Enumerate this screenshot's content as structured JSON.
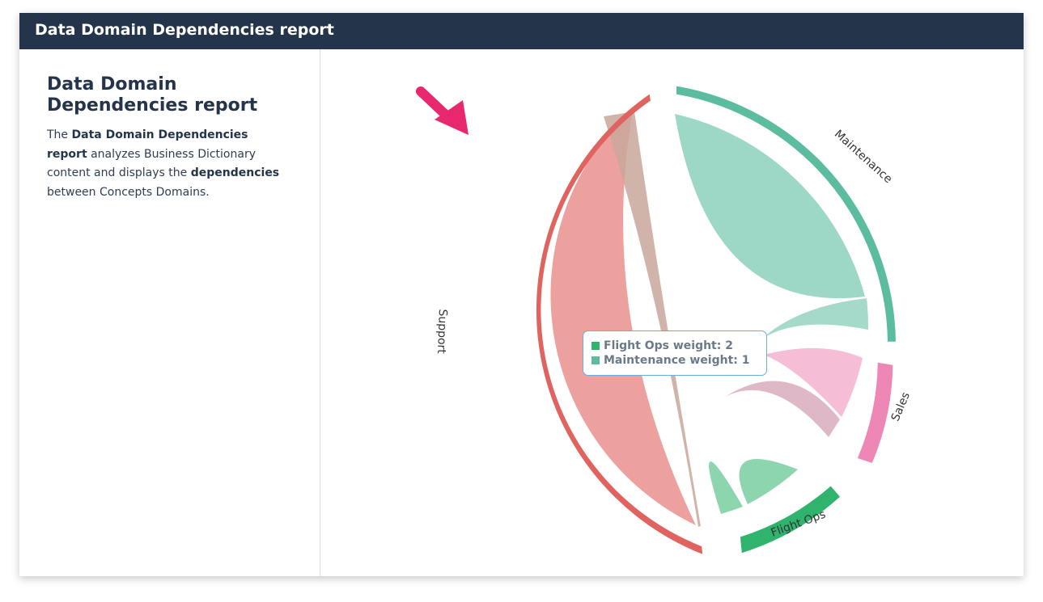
{
  "header": {
    "title": "Data Domain Dependencies report"
  },
  "panel": {
    "title": "Data Domain Dependencies report",
    "desc": {
      "p1": "The ",
      "b1": "Data Domain Dependencies report",
      "p2": " analyzes Business Dictionary content and displays the ",
      "b2": "dependencies",
      "p3": " between Concepts Domains."
    }
  },
  "diagram": {
    "type": "chord",
    "groups": [
      {
        "name": "Support",
        "color": "#e0635f"
      },
      {
        "name": "Maintenance",
        "color": "#5bbca0"
      },
      {
        "name": "Sales",
        "color": "#ee87b5"
      },
      {
        "name": "Flight Ops",
        "color": "#2fb36d"
      }
    ],
    "pointer": {
      "icon": "arrow-pointer-icon",
      "color": "#e8286e"
    }
  },
  "tooltip": {
    "rows": [
      {
        "label": "Flight Ops weight: 2",
        "color": "#2fb36d"
      },
      {
        "label": "Maintenance weight: 1",
        "color": "#5bbca0"
      }
    ]
  }
}
